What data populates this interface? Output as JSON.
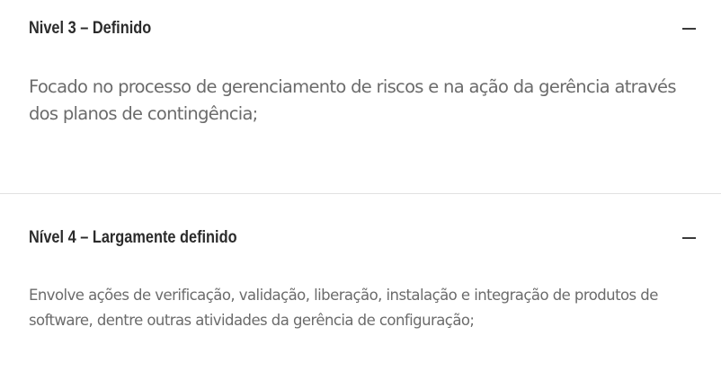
{
  "accordion": [
    {
      "title": "Nivel 3 – Definido",
      "expanded": true,
      "toggle_icon": "minus-icon",
      "body": "Focado no processo de gerenciamento de riscos e na ação da gerência através dos planos de contingência;"
    },
    {
      "title": "Nível 4 – Largamente definido",
      "expanded": true,
      "toggle_icon": "minus-icon",
      "body": "Envolve ações de verificação, validação, liberação, instalação e integração de produtos de software, dentre outras atividades da gerência de configuração;"
    }
  ]
}
